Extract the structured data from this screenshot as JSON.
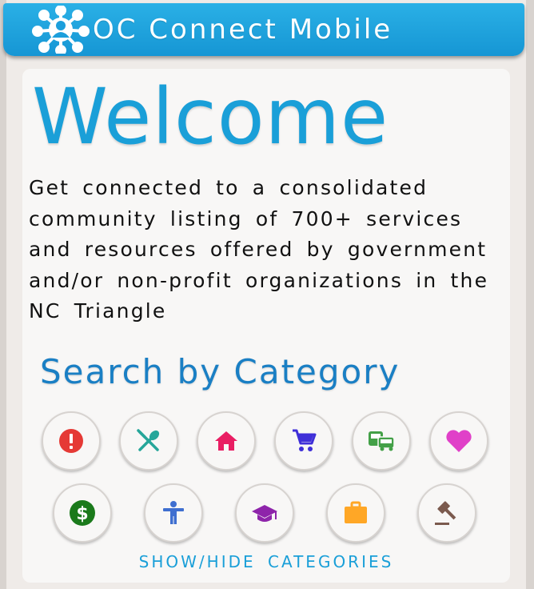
{
  "header": {
    "app_title": "OC Connect Mobile",
    "logo_icon": "people-network-logo-icon"
  },
  "main": {
    "welcome": "Welcome",
    "intro": "Get connected to a consolidated community listing of 700+ services and resources offered by government and/or non-profit organizations in the NC Triangle",
    "section_title": "Search by Category",
    "toggle_label": "SHOW/HIDE CATEGORIES"
  },
  "categories": [
    {
      "icon": "alert-icon",
      "color": "#e53935"
    },
    {
      "icon": "food-icon",
      "color": "#26a69a"
    },
    {
      "icon": "home-icon",
      "color": "#e91e63"
    },
    {
      "icon": "shopping-cart-icon",
      "color": "#3f2fd8"
    },
    {
      "icon": "transportation-icon",
      "color": "#43a047"
    },
    {
      "icon": "heart-icon",
      "color": "#e040c8"
    },
    {
      "icon": "dollar-icon",
      "color": "#1b7a1b"
    },
    {
      "icon": "accessibility-icon",
      "color": "#3f6fd0"
    },
    {
      "icon": "education-icon",
      "color": "#8e24aa"
    },
    {
      "icon": "briefcase-icon",
      "color": "#ffa726"
    },
    {
      "icon": "legal-gavel-icon",
      "color": "#7b5a4e"
    }
  ]
}
